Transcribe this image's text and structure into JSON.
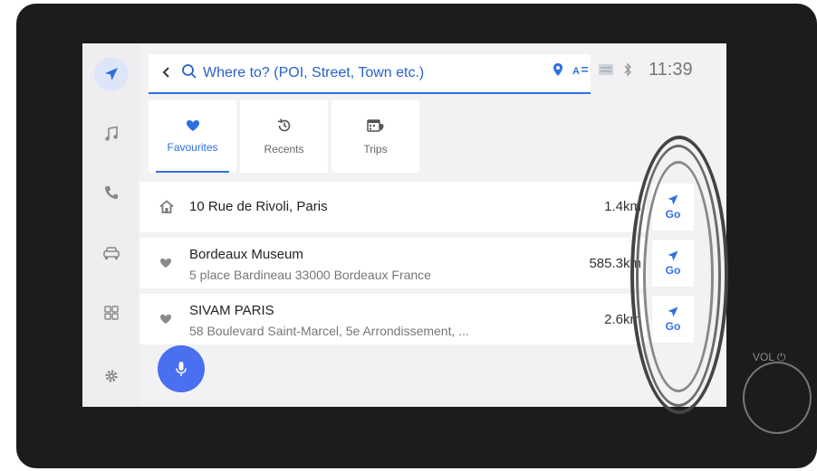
{
  "search": {
    "back_icon": "chevron-left-icon",
    "search_icon": "search-icon",
    "placeholder": "Where to? (POI, Street, Town etc.)"
  },
  "status": {
    "clock": "11:39",
    "icons": [
      "location-pin-icon",
      "text-size-icon",
      "dcm-icon",
      "bluetooth-icon"
    ]
  },
  "rail": {
    "items": [
      {
        "name": "navigation",
        "icon": "navigation-arrow-icon",
        "active": true
      },
      {
        "name": "music",
        "icon": "music-note-icon"
      },
      {
        "name": "phone",
        "icon": "phone-icon"
      },
      {
        "name": "vehicle",
        "icon": "car-icon"
      },
      {
        "name": "apps",
        "icon": "apps-grid-icon"
      },
      {
        "name": "settings",
        "icon": "gear-icon"
      }
    ]
  },
  "tabs": [
    {
      "label": "Favourites",
      "icon": "heart-icon",
      "active": true
    },
    {
      "label": "Recents",
      "icon": "history-icon"
    },
    {
      "label": "Trips",
      "icon": "calendar-pin-icon"
    }
  ],
  "favourites": [
    {
      "icon": "home-icon",
      "title": "10 Rue de Rivoli, Paris",
      "subtitle": "",
      "distance": "1.4km",
      "go_label": "Go"
    },
    {
      "icon": "heart-icon",
      "title": "Bordeaux Museum",
      "subtitle": "5 place Bardineau 33000 Bordeaux France",
      "distance": "585.3km",
      "go_label": "Go"
    },
    {
      "icon": "heart-icon",
      "title": "SIVAM PARIS",
      "subtitle": "58 Boulevard Saint-Marcel, 5e Arrondissement, ...",
      "distance": "2.6km",
      "go_label": "Go"
    }
  ],
  "hardware": {
    "vol_label": "VOL"
  },
  "colors": {
    "accent": "#2f6fe0",
    "mic_button": "#4a6ff0",
    "bezel": "#1c1c1c"
  }
}
